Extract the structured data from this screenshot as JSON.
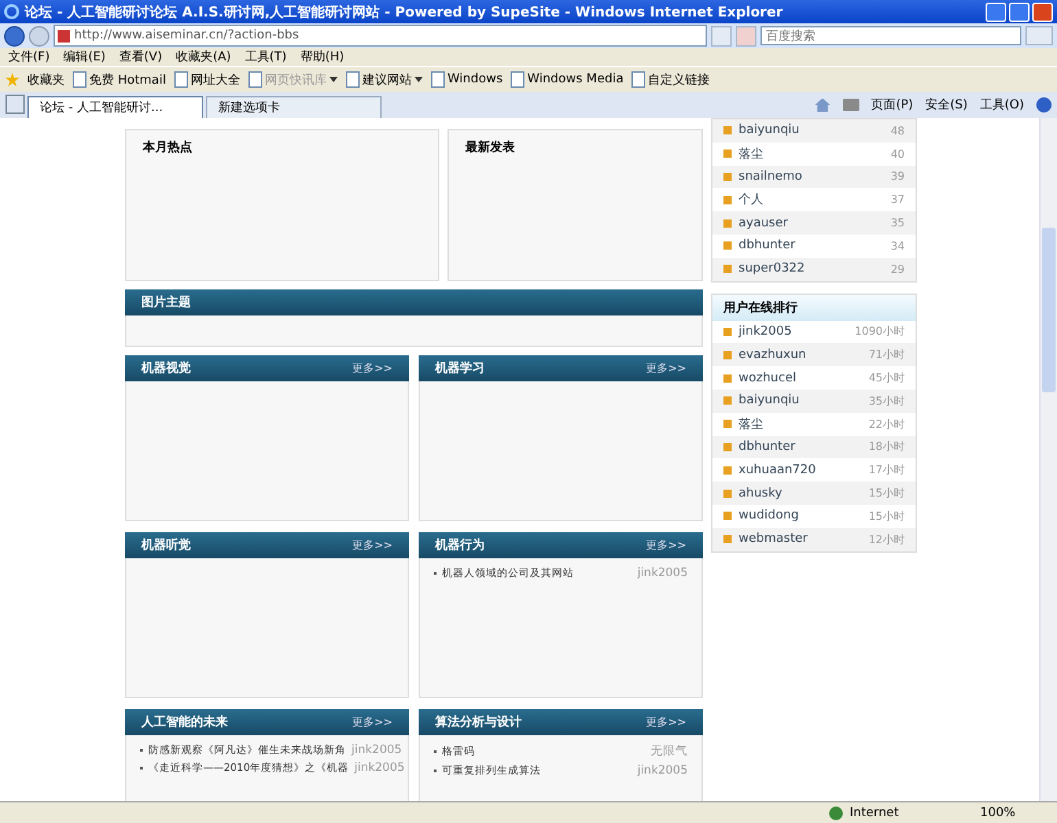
{
  "window": {
    "title": "论坛 - 人工智能研讨论坛 A.I.S.研讨网,人工智能研讨网站 - Powered by SupeSite - Windows Internet Explorer"
  },
  "address_bar": {
    "url": "http://www.aiseminar.cn/?action-bbs"
  },
  "search": {
    "placeholder": "百度搜索"
  },
  "menu": [
    "文件(F)",
    "编辑(E)",
    "查看(V)",
    "收藏夹(A)",
    "工具(T)",
    "帮助(H)"
  ],
  "favorites_bar": {
    "label": "收藏夹",
    "links": [
      {
        "label": "免费 Hotmail",
        "disabled": false,
        "dropdown": false
      },
      {
        "label": "网址大全",
        "disabled": false,
        "dropdown": false
      },
      {
        "label": "网页快讯库",
        "disabled": true,
        "dropdown": true
      },
      {
        "label": "建议网站",
        "disabled": false,
        "dropdown": true
      },
      {
        "label": "Windows",
        "disabled": false,
        "dropdown": false
      },
      {
        "label": "Windows Media",
        "disabled": false,
        "dropdown": false
      },
      {
        "label": "自定义链接",
        "disabled": false,
        "dropdown": false
      }
    ]
  },
  "tabs": [
    {
      "label": "论坛 - 人工智能研讨...",
      "selected": true
    },
    {
      "label": "新建选项卡",
      "selected": false
    }
  ],
  "command_bar": [
    "页面(P)",
    "安全(S)",
    "工具(O)"
  ],
  "top_boxes": [
    {
      "title": "本月热点"
    },
    {
      "title": "最新发表"
    }
  ],
  "picture_section": {
    "title": "图片主题"
  },
  "sections": [
    {
      "title": "机器视觉",
      "more": "更多>>"
    },
    {
      "title": "机器学习",
      "more": "更多>>"
    },
    {
      "title": "机器听觉",
      "more": "更多>>"
    },
    {
      "title": "机器行为",
      "more": "更多>>",
      "items": [
        {
          "title": "机器人领域的公司及其网站",
          "author": "jink2005"
        }
      ]
    },
    {
      "title": "人工智能的未来",
      "more": "更多>>",
      "items": [
        {
          "title": "防感新观察《阿凡达》催生未来战场新角",
          "author": "jink2005"
        },
        {
          "title": "《走近科学——2010年度猜想》之《机器",
          "author": "jink2005"
        }
      ]
    },
    {
      "title": "算法分析与设计",
      "more": "更多>>",
      "items": [
        {
          "title": "格雷码",
          "author": "无限气"
        },
        {
          "title": "可重复排列生成算法",
          "author": "jink2005"
        }
      ]
    }
  ],
  "post_ranking": [
    {
      "name": "baiyunqiu",
      "count": "48"
    },
    {
      "name": "落尘",
      "count": "40"
    },
    {
      "name": "snailnemo",
      "count": "39"
    },
    {
      "name": "个人",
      "count": "37"
    },
    {
      "name": "ayauser",
      "count": "35"
    },
    {
      "name": "dbhunter",
      "count": "34"
    },
    {
      "name": "super0322",
      "count": "29"
    }
  ],
  "online_ranking": {
    "title": "用户在线排行",
    "rows": [
      {
        "name": "jink2005",
        "count": "1090小时"
      },
      {
        "name": "evazhuxun",
        "count": "71小时"
      },
      {
        "name": "wozhucel",
        "count": "45小时"
      },
      {
        "name": "baiyunqiu",
        "count": "35小时"
      },
      {
        "name": "落尘",
        "count": "22小时"
      },
      {
        "name": "dbhunter",
        "count": "18小时"
      },
      {
        "name": "xuhuaan720",
        "count": "17小时"
      },
      {
        "name": "ahusky",
        "count": "15小时"
      },
      {
        "name": "wudidong",
        "count": "15小时"
      },
      {
        "name": "webmaster",
        "count": "12小时"
      }
    ]
  },
  "status_bar": {
    "zone": "Internet",
    "zoom": "100%"
  }
}
